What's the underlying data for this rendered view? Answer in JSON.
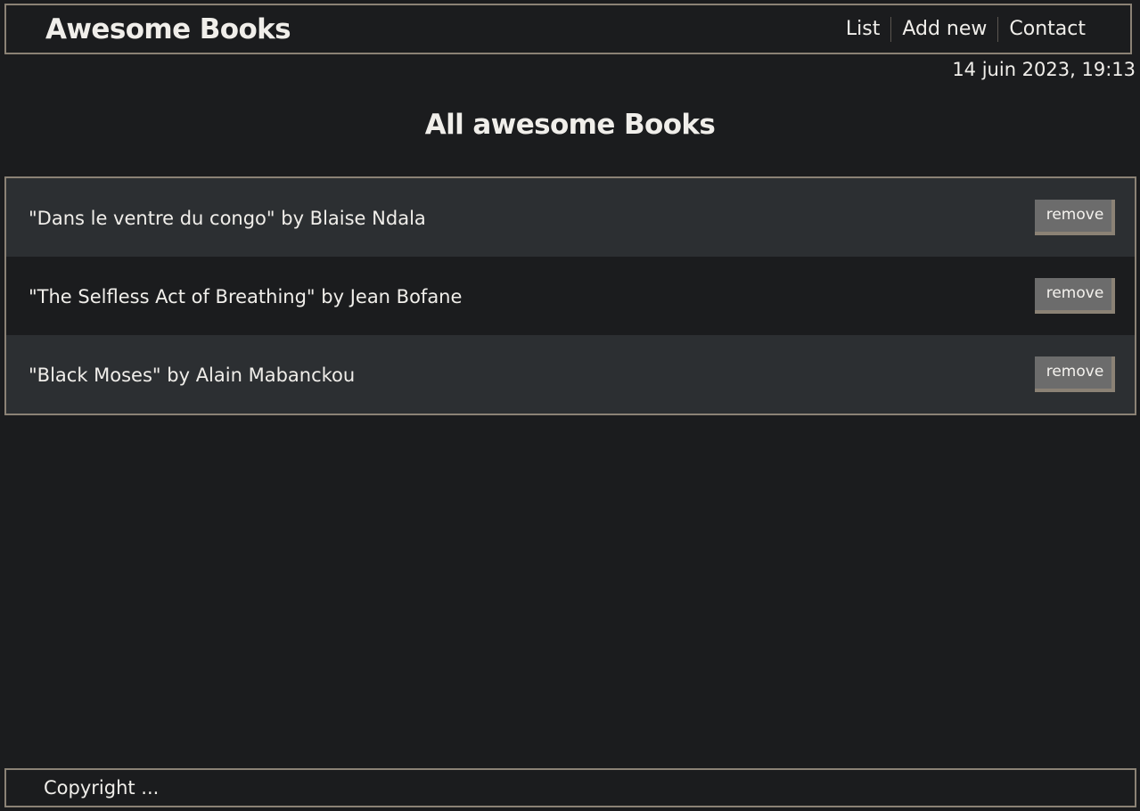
{
  "header": {
    "brand": "Awesome Books",
    "nav": {
      "list": "List",
      "add_new": "Add new",
      "contact": "Contact"
    }
  },
  "datetime": "14 juin 2023, 19:13",
  "main": {
    "title": "All awesome Books",
    "books": [
      {
        "text": "\"Dans le ventre du congo\" by Blaise Ndala",
        "action": "remove"
      },
      {
        "text": "\"The Selfless Act of Breathing\" by Jean Bofane",
        "action": "remove"
      },
      {
        "text": "\"Black Moses\" by Alain Mabanckou",
        "action": "remove"
      }
    ]
  },
  "footer": {
    "copyright": "Copyright ..."
  },
  "colors": {
    "background": "#1b1c1e",
    "row_alt": "#2c2f32",
    "border": "#8b8275",
    "button": "#6c6c6c",
    "text": "#f0eeea"
  }
}
